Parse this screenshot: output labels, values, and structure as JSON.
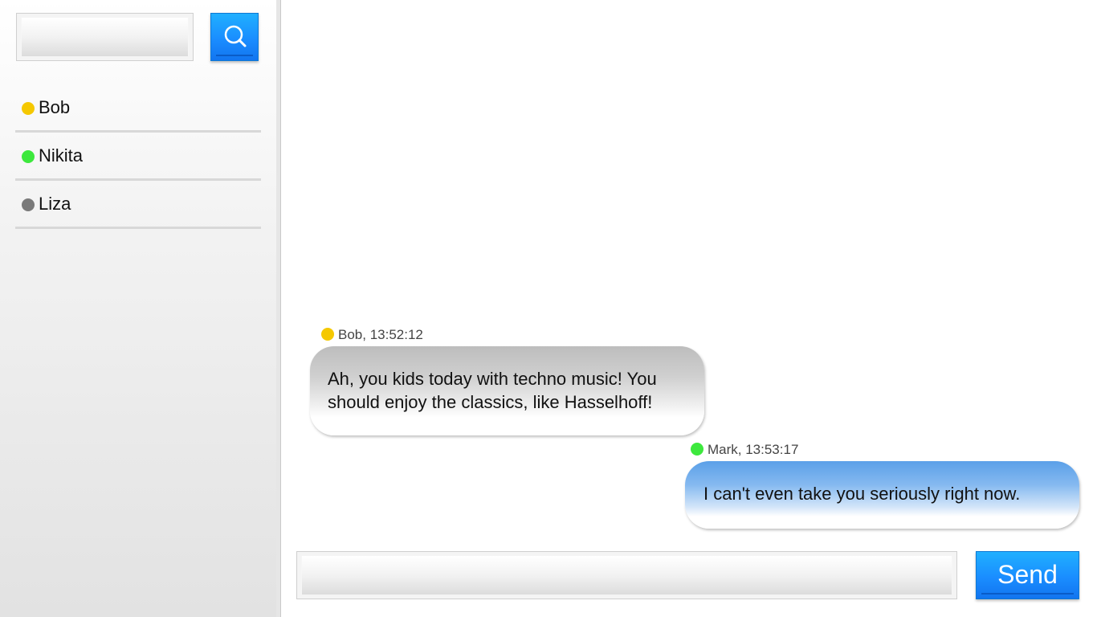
{
  "search": {
    "value": "",
    "placeholder": "",
    "button_icon": "search-icon"
  },
  "contacts": [
    {
      "name": "Bob",
      "status_color": "#f5c800"
    },
    {
      "name": "Nikita",
      "status_color": "#3de83d"
    },
    {
      "name": "Liza",
      "status_color": "#7a7a7a"
    }
  ],
  "messages": [
    {
      "sender": "Bob",
      "meta": "Bob, 13:52:12",
      "status_color": "#f5c800",
      "text": "Ah, you kids today with techno music! You should enjoy the classics, like Hasselhoff!"
    },
    {
      "sender": "Mark",
      "meta": "Mark, 13:53:17",
      "status_color": "#3de83d",
      "text": "I can't even take you seriously right now."
    }
  ],
  "compose": {
    "value": "",
    "placeholder": "",
    "send_label": "Send"
  },
  "colors": {
    "accent": "#1a8dff",
    "bubble_incoming": "#c8c8c8",
    "bubble_outgoing": "#6aa8ec"
  }
}
